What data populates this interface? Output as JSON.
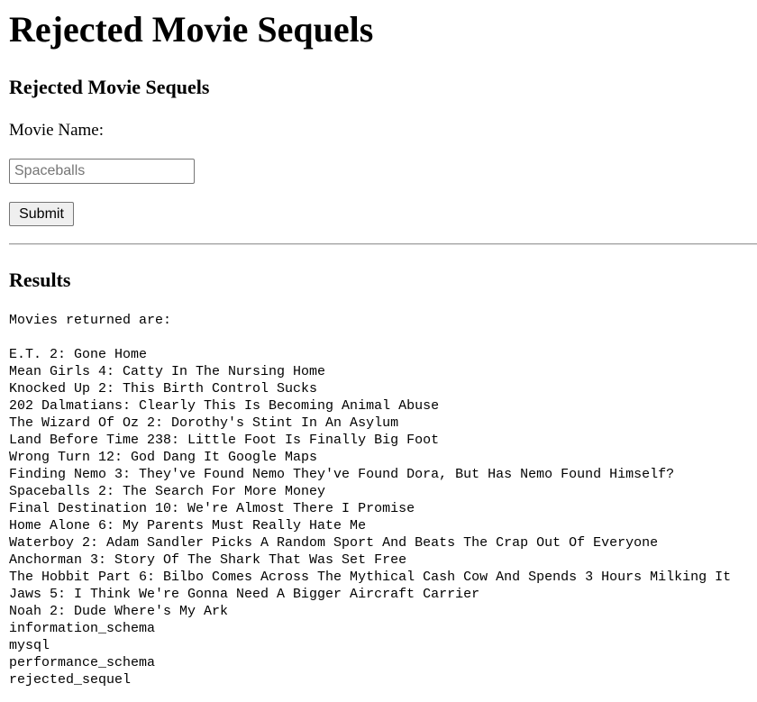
{
  "page": {
    "title": "Rejected Movie Sequels"
  },
  "form": {
    "heading": "Rejected Movie Sequels",
    "label": "Movie Name:",
    "input_placeholder": "Spaceballs",
    "input_value": "",
    "submit_label": "Submit"
  },
  "results": {
    "heading": "Results",
    "intro": "Movies returned are:",
    "items": [
      "E.T. 2: Gone Home",
      "Mean Girls 4: Catty In The Nursing Home",
      "Knocked Up 2: This Birth Control Sucks",
      "202 Dalmatians: Clearly This Is Becoming Animal Abuse",
      "The Wizard Of Oz 2: Dorothy's Stint In An Asylum",
      "Land Before Time 238: Little Foot Is Finally Big Foot",
      "Wrong Turn 12: God Dang It Google Maps",
      "Finding Nemo 3: They've Found Nemo They've Found Dora, But Has Nemo Found Himself?",
      "Spaceballs 2: The Search For More Money",
      "Final Destination 10: We're Almost There I Promise",
      "Home Alone 6: My Parents Must Really Hate Me",
      "Waterboy 2: Adam Sandler Picks A Random Sport And Beats The Crap Out Of Everyone",
      "Anchorman 3: Story Of The Shark That Was Set Free",
      "The Hobbit Part 6: Bilbo Comes Across The Mythical Cash Cow And Spends 3 Hours Milking It",
      "Jaws 5: I Think We're Gonna Need A Bigger Aircraft Carrier",
      "Noah 2: Dude Where's My Ark",
      "information_schema",
      "mysql",
      "performance_schema",
      "rejected_sequel"
    ]
  }
}
